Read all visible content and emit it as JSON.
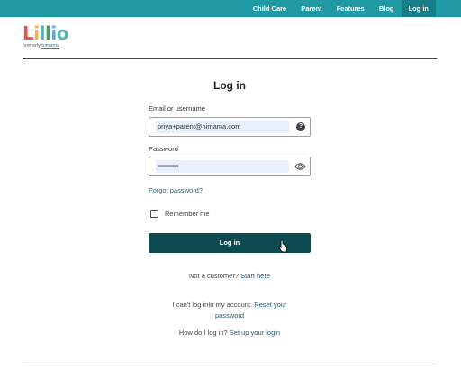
{
  "nav": {
    "items": [
      {
        "label": "Child Care"
      },
      {
        "label": "Parent"
      },
      {
        "label": "Features"
      },
      {
        "label": "Blog"
      },
      {
        "label": "Log in"
      }
    ],
    "active": "Log in"
  },
  "logo": {
    "word": "Lillio",
    "sub_prefix": "formerly",
    "sub_brand": "himama"
  },
  "form": {
    "title": "Log in",
    "email_label": "Email or username",
    "email_value": "priya+parent@himama.com",
    "password_label": "Password",
    "password_value": "••••••••••••••",
    "forgot_link": "Forgot password?",
    "remember_label": "Remember me",
    "remember_checked": false,
    "login_button": "Log in"
  },
  "footer_links": {
    "not_customer_text": "Not a customer?",
    "start_here": "Start here",
    "cant_login_text": "I can't log into my account.",
    "reset_password": "Reset your password",
    "how_login_text": "How do I log in?",
    "setup_login": "Set up your login"
  },
  "colors": {
    "topbar": "#1f9aa3",
    "active_nav": "#157e86",
    "button": "#0c4a4f",
    "link": "#1e6b73",
    "autofill": "#e8f0fe"
  },
  "icons": {
    "email_help": "question-circle-icon",
    "password_toggle": "eye-icon",
    "cursor": "pointer-hand-icon"
  }
}
